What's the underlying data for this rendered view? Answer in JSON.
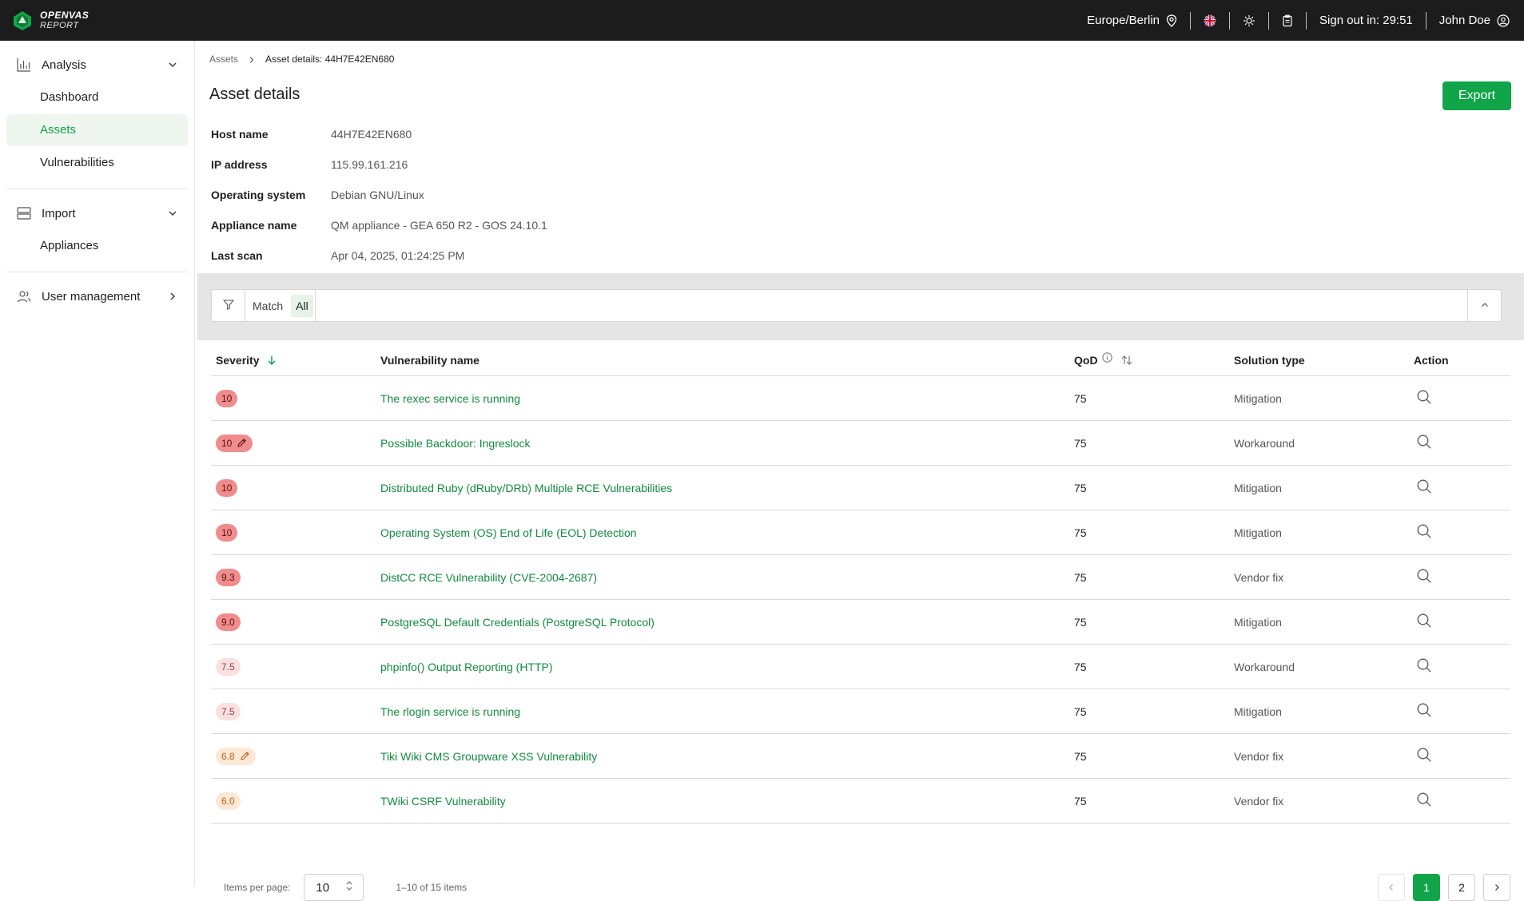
{
  "brand": {
    "line1": "OPENVAS",
    "line2": "REPORT"
  },
  "topbar": {
    "timezone": "Europe/Berlin",
    "signout": "Sign out in: 29:51",
    "user": "John Doe"
  },
  "sidebar": {
    "groups": [
      {
        "label": "Analysis",
        "items": [
          "Dashboard",
          "Assets",
          "Vulnerabilities"
        ]
      },
      {
        "label": "Import",
        "items": [
          "Appliances"
        ]
      },
      {
        "label": "User management"
      }
    ]
  },
  "breadcrumb": {
    "parent": "Assets",
    "current": "Asset details: 44H7E42EN680"
  },
  "page": {
    "title": "Asset details",
    "export_label": "Export"
  },
  "details": [
    {
      "key": "Host name",
      "value": "44H7E42EN680"
    },
    {
      "key": "IP address",
      "value": "115.99.161.216"
    },
    {
      "key": "Operating system",
      "value": "Debian GNU/Linux"
    },
    {
      "key": "Appliance name",
      "value": "QM appliance - GEA 650 R2 - GOS 24.10.1"
    },
    {
      "key": "Last scan",
      "value": "Apr 04, 2025, 01:24:25 PM"
    }
  ],
  "filter": {
    "match_label": "Match",
    "match_value": "All"
  },
  "table": {
    "headers": {
      "severity": "Severity",
      "name": "Vulnerability name",
      "qod": "QoD",
      "solution": "Solution type",
      "action": "Action"
    },
    "rows": [
      {
        "severity": "10",
        "level": "high",
        "edited": false,
        "name": "The rexec service is running",
        "qod": "75",
        "solution": "Mitigation"
      },
      {
        "severity": "10",
        "level": "high",
        "edited": true,
        "name": "Possible Backdoor: Ingreslock",
        "qod": "75",
        "solution": "Workaround"
      },
      {
        "severity": "10",
        "level": "high",
        "edited": false,
        "name": "Distributed Ruby (dRuby/DRb) Multiple RCE Vulnerabilities",
        "qod": "75",
        "solution": "Mitigation"
      },
      {
        "severity": "10",
        "level": "high",
        "edited": false,
        "name": "Operating System (OS) End of Life (EOL) Detection",
        "qod": "75",
        "solution": "Mitigation"
      },
      {
        "severity": "9.3",
        "level": "high",
        "edited": false,
        "name": "DistCC RCE Vulnerability (CVE-2004-2687)",
        "qod": "75",
        "solution": "Vendor fix"
      },
      {
        "severity": "9.0",
        "level": "high",
        "edited": false,
        "name": "PostgreSQL Default Credentials (PostgreSQL Protocol)",
        "qod": "75",
        "solution": "Mitigation"
      },
      {
        "severity": "7.5",
        "level": "med",
        "edited": false,
        "name": "phpinfo() Output Reporting (HTTP)",
        "qod": "75",
        "solution": "Workaround"
      },
      {
        "severity": "7.5",
        "level": "med",
        "edited": false,
        "name": "The rlogin service is running",
        "qod": "75",
        "solution": "Mitigation"
      },
      {
        "severity": "6.8",
        "level": "low",
        "edited": true,
        "name": "Tiki Wiki CMS Groupware XSS Vulnerability",
        "qod": "75",
        "solution": "Vendor fix"
      },
      {
        "severity": "6.0",
        "level": "low",
        "edited": false,
        "name": "TWiki CSRF Vulnerability",
        "qod": "75",
        "solution": "Vendor fix"
      }
    ]
  },
  "pager": {
    "items_per_page_label": "Items per page:",
    "items_per_page": "10",
    "range": "1–10 of 15 items",
    "pages": [
      "1",
      "2"
    ],
    "current_page": "1"
  },
  "colors": {
    "accent": "#11a54a",
    "link": "#138a3f",
    "topbar": "#1c1c1c",
    "severity_high": "#f08c8c",
    "severity_medium": "#fbe0e0",
    "severity_low": "#fde8d5"
  },
  "icons": {
    "timezone": "location-pin-icon",
    "language": "uk-flag-icon",
    "theme": "sun-icon",
    "notes": "clipboard-icon",
    "user": "user-circle-icon",
    "filter": "funnel-icon",
    "action": "search-icon",
    "qod_info": "info-icon",
    "edit": "pencil-icon"
  }
}
